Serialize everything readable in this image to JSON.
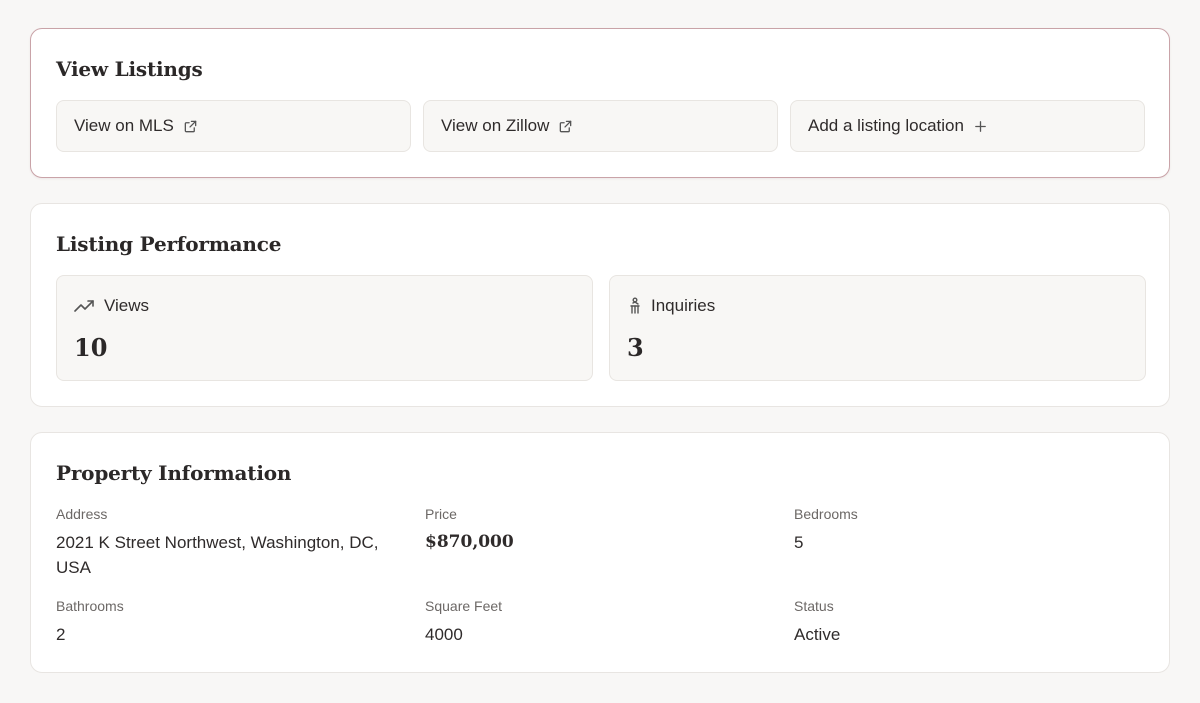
{
  "view_listings": {
    "title": "View Listings",
    "buttons": [
      {
        "label": "View on MLS",
        "icon": "external-link-icon"
      },
      {
        "label": "View on Zillow",
        "icon": "external-link-icon"
      },
      {
        "label": "Add a listing location",
        "icon": "plus-icon"
      }
    ]
  },
  "listing_performance": {
    "title": "Listing Performance",
    "stats": [
      {
        "label": "Views",
        "value": "10",
        "icon": "trending-up-icon"
      },
      {
        "label": "Inquiries",
        "value": "3",
        "icon": "hand-raised-icon"
      }
    ]
  },
  "property_information": {
    "title": "Property Information",
    "fields": [
      {
        "label": "Address",
        "value": "2021 K Street Northwest, Washington, DC, USA"
      },
      {
        "label": "Price",
        "value": "$870,000"
      },
      {
        "label": "Bedrooms",
        "value": "5"
      },
      {
        "label": "Bathrooms",
        "value": "2"
      },
      {
        "label": "Square Feet",
        "value": "4000"
      },
      {
        "label": "Status",
        "value": "Active"
      }
    ]
  },
  "colors": {
    "background": "#f8f7f6",
    "card": "#ffffff",
    "accent_border": "#c9a3a8",
    "text": "#2a2727",
    "muted_text": "#6c6866"
  }
}
